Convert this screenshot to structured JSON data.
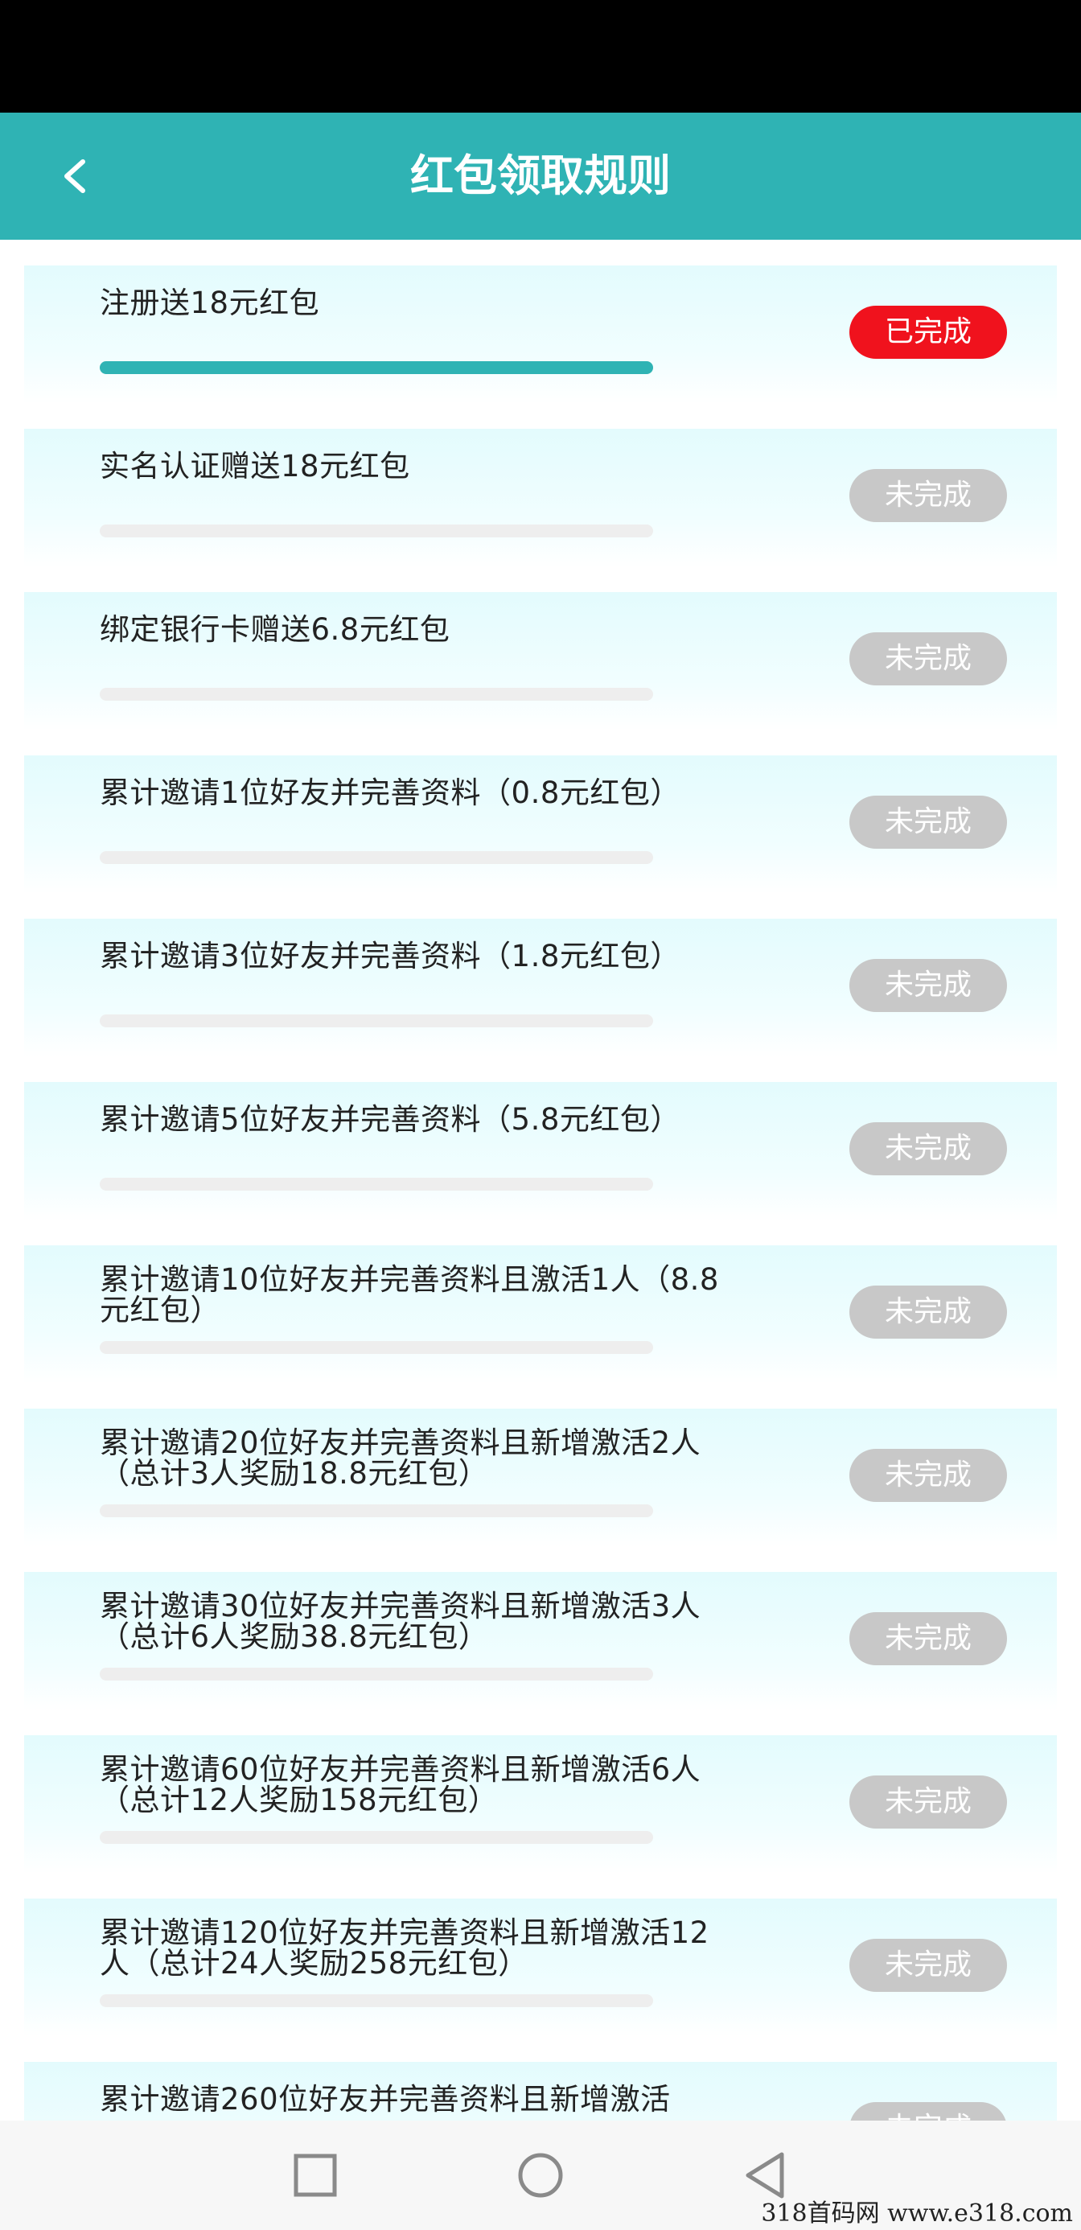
{
  "header": {
    "title": "红包领取规则",
    "back_icon": "chevron-left-icon"
  },
  "colors": {
    "accent": "#2fb3b4",
    "done": "#f0121d",
    "pending": "#c8c8c8"
  },
  "tasks": [
    {
      "text": "注册送18元红包",
      "status": "已完成",
      "completed": true,
      "progress": 1
    },
    {
      "text": "实名认证赠送18元红包",
      "status": "未完成",
      "completed": false,
      "progress": 0
    },
    {
      "text": "绑定银行卡赠送6.8元红包",
      "status": "未完成",
      "completed": false,
      "progress": 0
    },
    {
      "text": "累计邀请1位好友并完善资料（0.8元红包）",
      "status": "未完成",
      "completed": false,
      "progress": 0
    },
    {
      "text": "累计邀请3位好友并完善资料（1.8元红包）",
      "status": "未完成",
      "completed": false,
      "progress": 0
    },
    {
      "text": "累计邀请5位好友并完善资料（5.8元红包）",
      "status": "未完成",
      "completed": false,
      "progress": 0
    },
    {
      "text": "累计邀请10位好友并完善资料且激活1人（8.8元红包）",
      "status": "未完成",
      "completed": false,
      "progress": 0
    },
    {
      "text": "累计邀请20位好友并完善资料且新增激活2人（总计3人奖励18.8元红包）",
      "status": "未完成",
      "completed": false,
      "progress": 0
    },
    {
      "text": "累计邀请30位好友并完善资料且新增激活3人（总计6人奖励38.8元红包）",
      "status": "未完成",
      "completed": false,
      "progress": 0
    },
    {
      "text": "累计邀请60位好友并完善资料且新增激活6人（总计12人奖励158元红包）",
      "status": "未完成",
      "completed": false,
      "progress": 0
    },
    {
      "text": "累计邀请120位好友并完善资料且新增激活12人（总计24人奖励258元红包）",
      "status": "未完成",
      "completed": false,
      "progress": 0
    },
    {
      "text": "累计邀请260位好友并完善资料且新增激活",
      "status": "未完成",
      "completed": false,
      "progress": 0
    }
  ],
  "nav": {
    "recents_icon": "square-icon",
    "home_icon": "circle-icon",
    "back_icon": "triangle-back-icon"
  },
  "watermark": "318首码网 www.e318.com"
}
